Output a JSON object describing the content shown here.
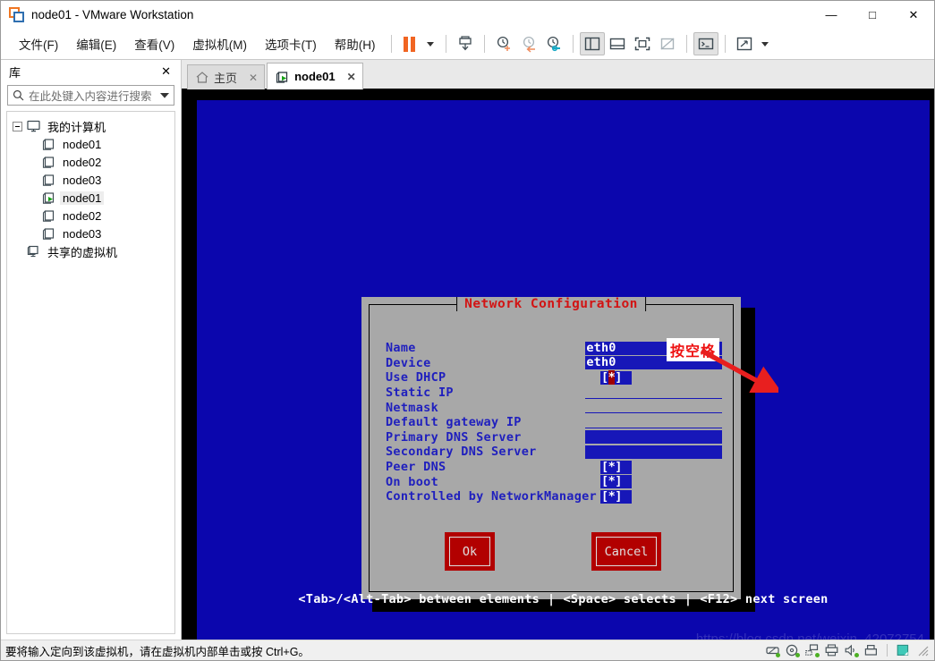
{
  "window": {
    "title": "node01 - VMware Workstation",
    "app_icon": "vmware-logo-icon",
    "minimize": "—",
    "maximize": "□",
    "close": "✕"
  },
  "menu": {
    "items": [
      {
        "label": "文件(F)",
        "accel": "F",
        "name": "menu-file"
      },
      {
        "label": "编辑(E)",
        "accel": "E",
        "name": "menu-edit"
      },
      {
        "label": "查看(V)",
        "accel": "V",
        "name": "menu-view"
      },
      {
        "label": "虚拟机(M)",
        "accel": "M",
        "name": "menu-vm"
      },
      {
        "label": "选项卡(T)",
        "accel": "T",
        "name": "menu-tabs"
      },
      {
        "label": "帮助(H)",
        "accel": "H",
        "name": "menu-help"
      }
    ]
  },
  "toolbar": {
    "icons": [
      "pause-icon",
      "chevron-down-icon",
      "power-dropdown-icon",
      "snapshot-icon",
      "take-snapshot-icon",
      "revert-snapshot-icon",
      "snapshot-manager-icon",
      "show-library-icon",
      "show-thumbnails-icon",
      "fullscreen-icon",
      "unity-mode-icon",
      "console-view-icon",
      "stretch-icon",
      "toolbar-chevron-icon"
    ]
  },
  "sidebar": {
    "title": "库",
    "close_label": "✕",
    "search": {
      "placeholder": "在此处键入内容进行搜索",
      "value": "",
      "icon": "search-icon",
      "dropdown_icon": "chevron-down-icon"
    },
    "tree": [
      {
        "label": "我的计算机",
        "icon": "my-computer-icon",
        "level": 0,
        "expander": true,
        "selected": false,
        "running": false
      },
      {
        "label": "node01",
        "icon": "vm-icon",
        "level": 1,
        "expander": false,
        "selected": false,
        "running": false
      },
      {
        "label": "node02",
        "icon": "vm-icon",
        "level": 1,
        "expander": false,
        "selected": false,
        "running": false
      },
      {
        "label": "node03",
        "icon": "vm-icon",
        "level": 1,
        "expander": false,
        "selected": false,
        "running": false
      },
      {
        "label": "node01",
        "icon": "vm-running-icon",
        "level": 1,
        "expander": false,
        "selected": true,
        "running": true
      },
      {
        "label": "node02",
        "icon": "vm-icon",
        "level": 1,
        "expander": false,
        "selected": false,
        "running": false
      },
      {
        "label": "node03",
        "icon": "vm-icon",
        "level": 1,
        "expander": false,
        "selected": false,
        "running": false
      },
      {
        "label": "共享的虚拟机",
        "icon": "shared-vms-icon",
        "level": 0,
        "expander": false,
        "selected": false,
        "running": false
      }
    ]
  },
  "tabs": [
    {
      "label": "主页",
      "icon": "home-icon",
      "active": false,
      "close": "✕"
    },
    {
      "label": "node01",
      "icon": "vm-running-icon",
      "active": true,
      "close": "✕"
    }
  ],
  "vm_screen": {
    "background_color": "#0b06ad",
    "dialog": {
      "title": "Network Configuration",
      "title_color": "#d21414",
      "background_color": "#a8a8a8",
      "label_color": "#1f1fbe",
      "field_color": "#1717b8",
      "fields": [
        {
          "label": "Name",
          "type": "text",
          "value": "eth0",
          "active": true,
          "cursor": false
        },
        {
          "label": "Device",
          "type": "text",
          "value": "eth0",
          "active": true,
          "cursor": false
        },
        {
          "label": "Use DHCP",
          "type": "checkbox",
          "value": "[*]",
          "active": true,
          "cursor": true
        },
        {
          "label": "Static IP",
          "type": "text",
          "value": "",
          "active": false,
          "cursor": false
        },
        {
          "label": "Netmask",
          "type": "text",
          "value": "",
          "active": false,
          "cursor": false
        },
        {
          "label": "Default gateway IP",
          "type": "text",
          "value": "",
          "active": false,
          "cursor": false
        },
        {
          "label": "Primary DNS Server",
          "type": "text",
          "value": "",
          "active": true,
          "cursor": false
        },
        {
          "label": "Secondary DNS Server",
          "type": "text",
          "value": "",
          "active": true,
          "cursor": false
        },
        {
          "label": "Peer DNS",
          "type": "checkbox",
          "value": "[*]",
          "active": true,
          "cursor": false
        },
        {
          "label": "On boot",
          "type": "checkbox",
          "value": "[*]",
          "active": true,
          "cursor": false
        },
        {
          "label": "Controlled by NetworkManager",
          "type": "checkbox",
          "value": "[*]",
          "active": true,
          "cursor": false
        }
      ],
      "buttons": [
        {
          "label": "Ok",
          "name": "ok-button"
        },
        {
          "label": "Cancel",
          "name": "cancel-button"
        }
      ]
    },
    "annotation": {
      "text": "按空格",
      "color": "#ee1111",
      "arrow": "red-arrow-icon"
    },
    "help_line": {
      "part1": "<Tab>/<Alt-Tab> between elements",
      "sep": "|",
      "part2": "<Space> selects",
      "part3": "<F12> next screen"
    },
    "watermark": "https://blog.csdn.net/weixin_42072754"
  },
  "statusbar": {
    "text": "要将输入定向到该虚拟机，请在虚拟机内部单击或按 Ctrl+G。",
    "devices": [
      "hard-disk-icon",
      "cd-dvd-icon",
      "network-adapter-icon",
      "printer-icon",
      "sound-card-icon",
      "usb-device-icon"
    ],
    "extra_icon": "message-log-icon",
    "grip": "resize-grip-icon"
  }
}
